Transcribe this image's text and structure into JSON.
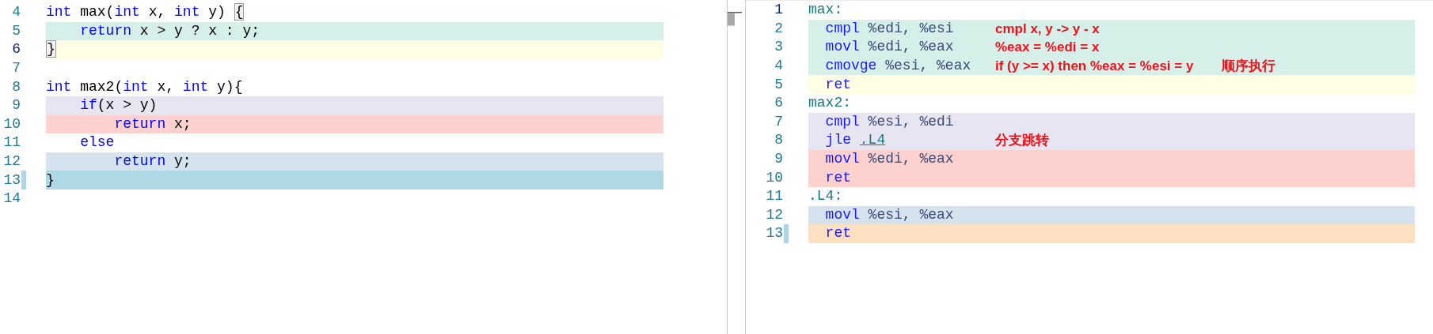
{
  "source_pane": {
    "lines": [
      {
        "number": "4",
        "tokens": [
          {
            "text": "int",
            "kind": "keyword"
          },
          {
            "text": " max(",
            "kind": "plain"
          },
          {
            "text": "int",
            "kind": "keyword"
          },
          {
            "text": " x, ",
            "kind": "plain"
          },
          {
            "text": "int",
            "kind": "keyword"
          },
          {
            "text": " y) ",
            "kind": "plain"
          },
          {
            "text": "{",
            "kind": "bracket"
          }
        ]
      },
      {
        "number": "5",
        "color": "#d7efe9",
        "tokens": [
          {
            "text": "    return",
            "kind": "keyword"
          },
          {
            "text": " x > y ? x : y;",
            "kind": "plain"
          }
        ]
      },
      {
        "number": "6",
        "color": "#fefee4",
        "current": true,
        "tokens": [
          {
            "text": "}",
            "kind": "bracket"
          }
        ]
      },
      {
        "number": "7"
      },
      {
        "number": "8",
        "tokens": [
          {
            "text": "int",
            "kind": "keyword"
          },
          {
            "text": " max2(",
            "kind": "plain"
          },
          {
            "text": "int",
            "kind": "keyword"
          },
          {
            "text": " x, ",
            "kind": "plain"
          },
          {
            "text": "int",
            "kind": "keyword"
          },
          {
            "text": " y){",
            "kind": "plain"
          }
        ]
      },
      {
        "number": "9",
        "color": "#e7e5f1",
        "tokens": [
          {
            "text": "    if",
            "kind": "keyword"
          },
          {
            "text": "(x > y)",
            "kind": "plain"
          }
        ]
      },
      {
        "number": "10",
        "color": "#fdd1cd",
        "tokens": [
          {
            "text": "        return",
            "kind": "keyword"
          },
          {
            "text": " x;",
            "kind": "plain"
          }
        ]
      },
      {
        "number": "11",
        "tokens": [
          {
            "text": "    else",
            "kind": "keyword"
          }
        ]
      },
      {
        "number": "12",
        "color": "#d4e3ee",
        "tokens": [
          {
            "text": "        return",
            "kind": "keyword"
          },
          {
            "text": " y;",
            "kind": "plain"
          }
        ]
      },
      {
        "number": "13",
        "color": "#aed8e4",
        "modified": true,
        "tokens": [
          {
            "text": "}",
            "kind": "plain"
          }
        ]
      },
      {
        "number": "14"
      }
    ]
  },
  "assembly_pane": {
    "lines": [
      {
        "number": "1",
        "current": true,
        "tokens": [
          {
            "text": "max:",
            "kind": "label"
          }
        ]
      },
      {
        "number": "2",
        "color": "#d7efe9",
        "tokens": [
          {
            "text": "  cmpl",
            "kind": "mnemonic"
          },
          {
            "text": " %edi, %esi",
            "kind": "register"
          }
        ],
        "annotations": [
          "cmpl x, y -> y - x"
        ]
      },
      {
        "number": "3",
        "color": "#d7efe9",
        "tokens": [
          {
            "text": "  movl",
            "kind": "mnemonic"
          },
          {
            "text": " %edi, %eax",
            "kind": "register"
          }
        ],
        "annotations": [
          "%eax = %edi = x"
        ]
      },
      {
        "number": "4",
        "color": "#d7efe9",
        "tokens": [
          {
            "text": "  cmovge",
            "kind": "mnemonic"
          },
          {
            "text": " %esi, %eax",
            "kind": "register"
          }
        ],
        "annotations": [
          "if (y >= x) then %eax = %esi = y",
          "顺序执行"
        ]
      },
      {
        "number": "5",
        "color": "#fefee4",
        "tokens": [
          {
            "text": "  ret",
            "kind": "mnemonic"
          }
        ]
      },
      {
        "number": "6",
        "tokens": [
          {
            "text": "max2:",
            "kind": "label"
          }
        ]
      },
      {
        "number": "7",
        "color": "#e7e5f1",
        "tokens": [
          {
            "text": "  cmpl",
            "kind": "mnemonic"
          },
          {
            "text": " %esi, %edi",
            "kind": "register"
          }
        ]
      },
      {
        "number": "8",
        "color": "#e7e5f1",
        "tokens": [
          {
            "text": "  jle ",
            "kind": "mnemonic"
          },
          {
            "text": ".L4",
            "kind": "link"
          }
        ],
        "annotations": [
          "分支跳转"
        ]
      },
      {
        "number": "9",
        "color": "#fdd1cd",
        "tokens": [
          {
            "text": "  movl",
            "kind": "mnemonic"
          },
          {
            "text": " %edi, %eax",
            "kind": "register"
          }
        ]
      },
      {
        "number": "10",
        "color": "#fdd1cd",
        "tokens": [
          {
            "text": "  ret",
            "kind": "mnemonic"
          }
        ]
      },
      {
        "number": "11",
        "tokens": [
          {
            "text": ".L4:",
            "kind": "label"
          }
        ]
      },
      {
        "number": "12",
        "color": "#d4e3ee",
        "tokens": [
          {
            "text": "  movl",
            "kind": "mnemonic"
          },
          {
            "text": " %esi, %eax",
            "kind": "register"
          }
        ]
      },
      {
        "number": "13",
        "color": "#fde0c1",
        "modified": true,
        "tokens": [
          {
            "text": "  ret",
            "kind": "mnemonic"
          }
        ]
      }
    ]
  }
}
